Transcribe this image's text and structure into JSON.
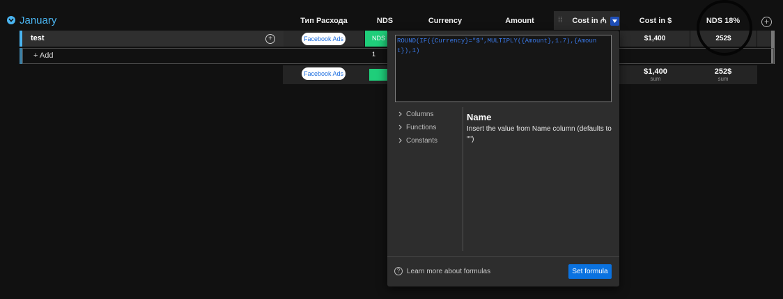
{
  "group": {
    "title": "January"
  },
  "columns": {
    "expense_type": "Тип Расхода",
    "nds": "NDS",
    "currency": "Currency",
    "amount": "Amount",
    "cost_in": "Cost in ₼",
    "cost_usd": "Cost in $",
    "nds18": "NDS 18%"
  },
  "row": {
    "name": "test",
    "expense_type": "Facebook Ads",
    "nds_label": "NDS 1",
    "cost_usd": "$1,400",
    "nds18": "252$"
  },
  "add_item": "+ Add",
  "summary": {
    "expense_type": "Facebook Ads",
    "cost_usd": "$1,400",
    "cost_usd_label": "sum",
    "nds18": "252$",
    "nds18_label": "sum"
  },
  "formula_popup": {
    "formula": "ROUND(IF({Currency}=\"$\",MULTIPLY({Amount},1.7),{Amount}),1)",
    "tree": [
      "Columns",
      "Functions",
      "Constants"
    ],
    "help_title": "Name",
    "help_desc": "Insert the value from Name column (defaults to \"\")",
    "learn_more": "Learn more about formulas",
    "set_button": "Set formula"
  },
  "colors": {
    "accent": "#4ab4f0",
    "status_green": "#1fce7a",
    "primary_button": "#0a72e0",
    "formula_text": "#3a78e6"
  },
  "icons": [
    "chevron-down-icon",
    "drag-handle-icon",
    "plus-circle-icon",
    "conversation-icon",
    "chevron-right-icon",
    "question-icon"
  ]
}
